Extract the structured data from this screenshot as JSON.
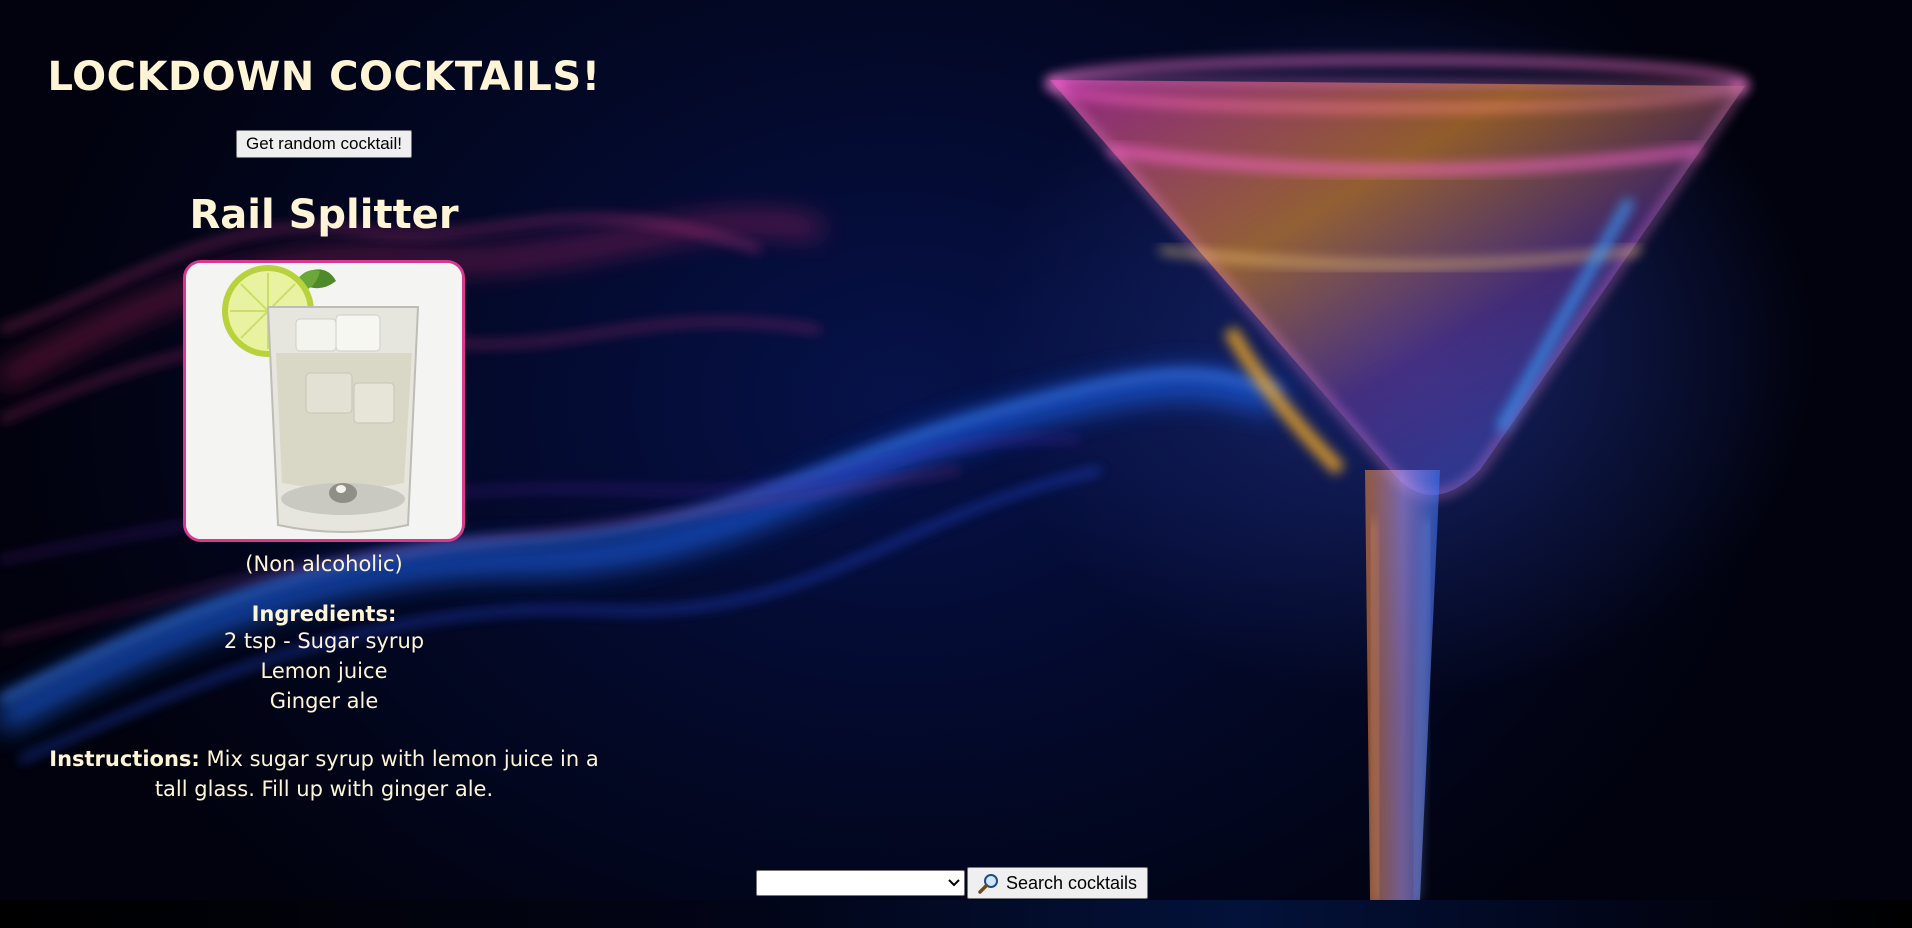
{
  "app": {
    "title": "LOCKDOWN COCKTAILS!"
  },
  "actions": {
    "random_label": "Get random cocktail!",
    "search_label": "Search cocktails",
    "category_selected": ""
  },
  "cocktail": {
    "name": "Rail Splitter",
    "alcoholic": "(Non alcoholic)",
    "ingredients_heading": "Ingredients:",
    "ingredients": [
      "2 tsp - Sugar syrup",
      "Lemon juice",
      "Ginger ale"
    ],
    "instructions_heading": "Instructions:",
    "instructions": "Mix sugar syrup with lemon juice in a tall glass. Fill up with ginger ale."
  },
  "icons": {
    "search": "magnifier-icon",
    "dropdown": "chevron-down-icon"
  },
  "colors": {
    "text": "#fff5d6",
    "photo_border": "#d8388e",
    "background": "#030826"
  }
}
